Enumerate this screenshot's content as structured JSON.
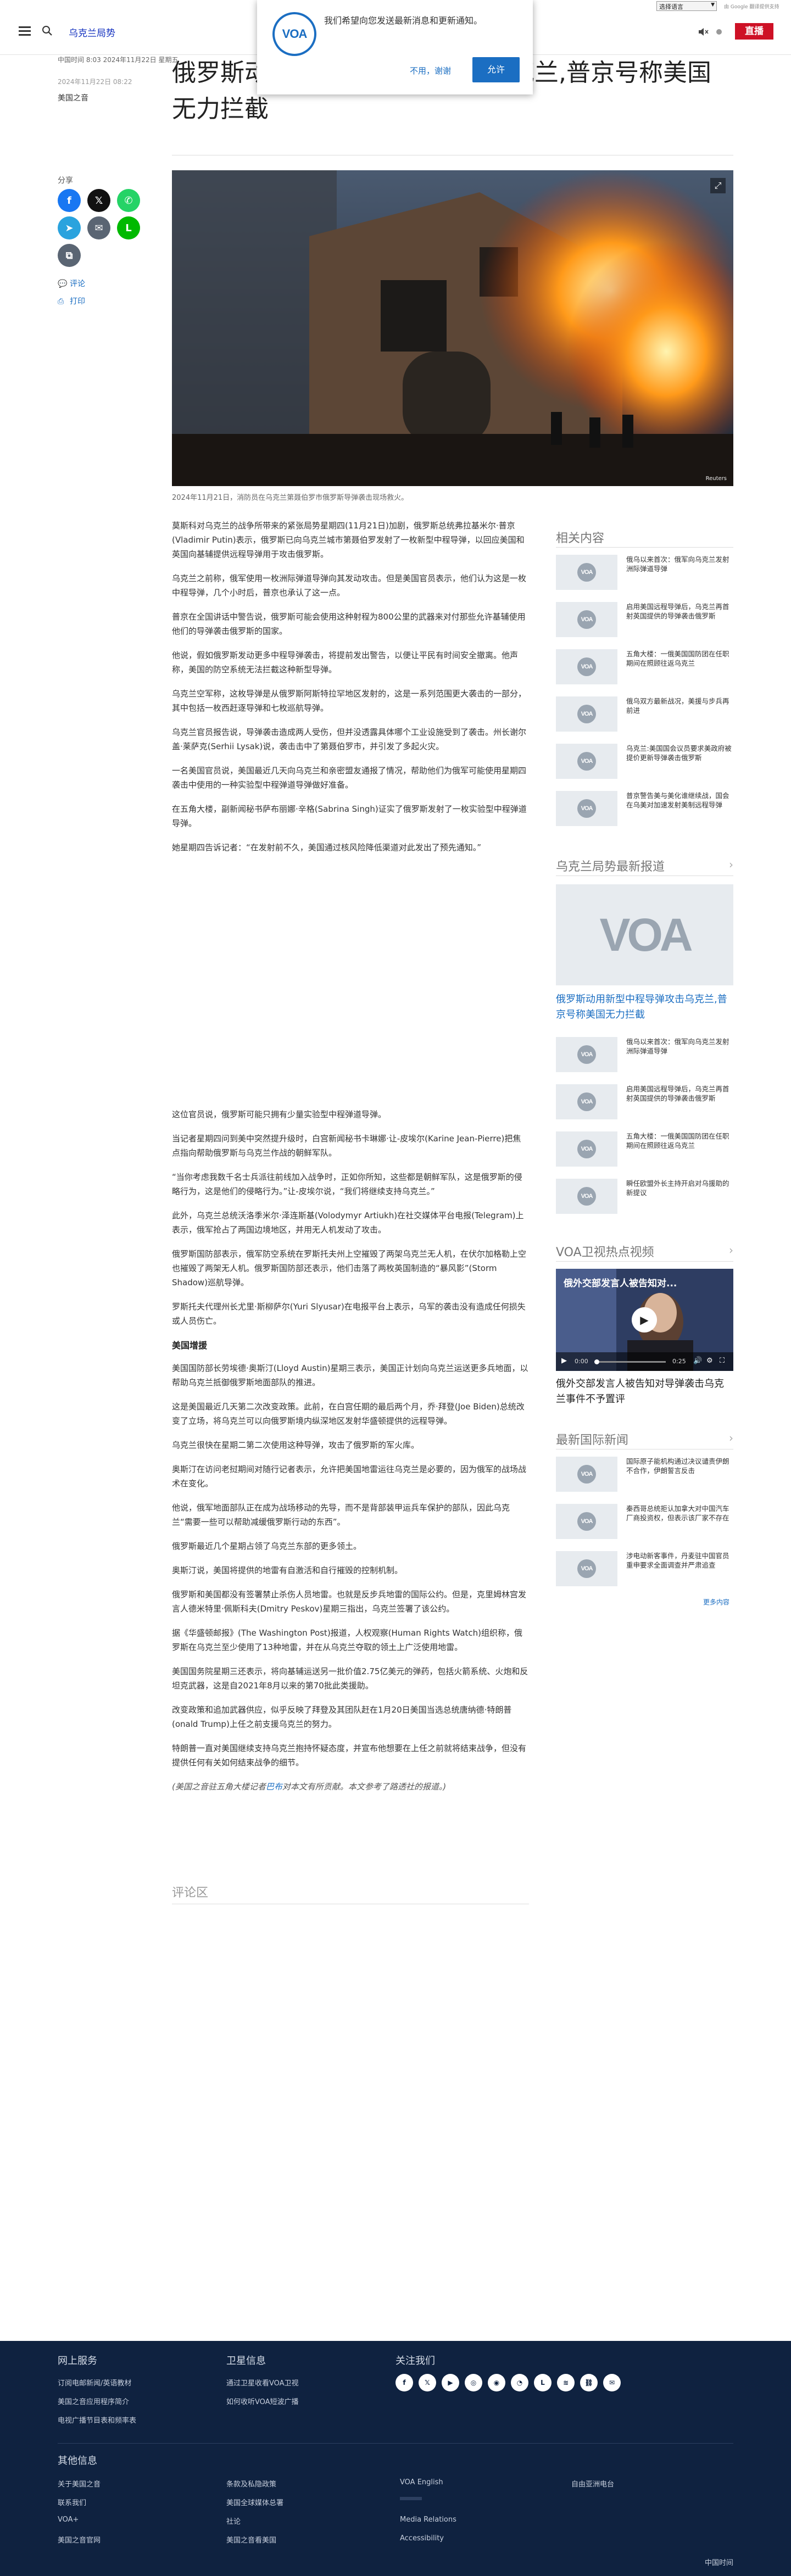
{
  "topbar": {
    "language_select": "选择语言",
    "google_translate": "由 Google 翻译提供支持"
  },
  "header": {
    "section_title": "乌克兰局势",
    "live_label": "直播"
  },
  "notification": {
    "text": "我们希望向您发送最新消息和更新通知。",
    "deny_label": "不用，谢谢",
    "allow_label": "允许",
    "logo_text": "VOA"
  },
  "article": {
    "meta": "中国时间 8:03 2024年11月22日 星期五",
    "date": "2024年11月22日 08:22",
    "source": "美国之音",
    "headline": "俄罗斯动用新型中程导弹攻击乌克兰,普京号称美国无力拦截",
    "caption": "2024年11月21日，消防员在乌克兰第聂伯罗市俄罗斯导弹袭击现场救火。",
    "photo_credit": "Reuters",
    "paragraphs_1": [
      "莫斯科对乌克兰的战争所带来的紧张局势星期四(11月21日)加剧，俄罗斯总统弗拉基米尔·普京(Vladimir Putin)表示，俄罗斯已向乌克兰城市第聂伯罗发射了一枚新型中程导弹，以回应美国和英国向基辅提供远程导弹用于攻击俄罗斯。",
      "乌克兰之前称，俄军使用一枚洲际弹道导弹向其发动攻击。但是美国官员表示，他们认为这是一枚中程导弹，几个小时后，普京也承认了这一点。",
      "普京在全国讲话中警告说，俄罗斯可能会使用这种射程为800公里的武器来对付那些允许基辅使用他们的导弹袭击俄罗斯的国家。",
      "他说，假如俄罗斯发动更多中程导弹袭击，将提前发出警告，以便让平民有时间安全撤离。他声称，美国的防空系统无法拦截这种新型导弹。",
      "乌克兰空军称，这枚导弹是从俄罗斯阿斯特拉罕地区发射的，这是一系列范围更大袭击的一部分，其中包括一枚西赶逐导弹和七枚巡航导弹。",
      "乌克兰官员报告说，导弹袭击造成两人受伤，但并没透露具体哪个工业设施受到了袭击。州长谢尔盖·莱萨克(Serhii Lysak)说，袭击击中了第聂伯罗市，并引发了多起火灾。",
      "一名美国官员说，美国最近几天向乌克兰和亲密盟友通报了情况，帮助他们为俄军可能使用星期四袭击中使用的一种实验型中程弹道导弹做好准备。",
      "在五角大楼，副新闻秘书萨布丽娜·辛格(Sabrina Singh)证实了俄罗斯发射了一枚实验型中程弹道导弹。",
      "她星期四告诉记者：“在发射前不久，美国通过核风险降低渠道对此发出了预先通知。”"
    ],
    "paragraphs_2": [
      "这位官员说，俄罗斯可能只拥有少量实验型中程弹道导弹。",
      "当记者星期四问到美中突然提升级时，白宫新闻秘书卡琳娜·让-皮埃尔(Karine Jean-Pierre)把焦点指向帮助俄罗斯与乌克兰作战的朝鲜军队。",
      "“当你考虑我数千名士兵派往前线加入战争时，正如你所知，这些都是朝鲜军队，这是俄罗斯的侵略行为，这是他们的侵略行为。”让-皮埃尔说，“我们将继续支持乌克兰。”",
      "此外，乌克兰总统沃洛季米尔·泽连斯基(Volodymyr Artiukh)在社交媒体平台电报(Telegram)上表示，俄军抢占了两国边境地区，并用无人机发动了攻击。",
      "俄罗斯国防部表示，俄军防空系统在罗斯托夫州上空摧毁了两架乌克兰无人机，在伏尔加格勒上空也摧毁了两架无人机。俄罗斯国防部还表示，他们击落了两枚英国制造的“暴风影”(Storm Shadow)巡航导弹。",
      "罗斯托夫代理州长尤里·斯柳萨尔(Yuri Slyusar)在电报平台上表示，乌军的袭击没有造成任何损失或人员伤亡。"
    ],
    "subhead": "美国增援",
    "paragraphs_3": [
      "美国国防部长劳埃德·奥斯汀(Lloyd Austin)星期三表示，美国正计划向乌克兰运送更多兵地面，以帮助乌克兰抵御俄罗斯地面部队的推进。",
      "这是美国最近几天第二次改变政策。此前，在白宫任期的最后两个月，乔·拜登(Joe Biden)总统改变了立场，将乌克兰可以向俄罗斯境内纵深地区发射华盛顿提供的远程导弹。",
      "乌克兰很快在星期二第二次使用这种导弹，攻击了俄罗斯的军火库。",
      "奥斯汀在访问老挝期间对随行记者表示，允许把美国地雷运往乌克兰是必要的，因为俄军的战场战术在变化。",
      "他说，俄军地面部队正在成为战场移动的先导，而不是背部装甲运兵车保护的部队，因此乌克兰“需要一些可以帮助减缓俄罗斯行动的东西”。",
      "俄罗斯最近几个星期占领了乌克兰东部的更多领土。",
      "奥斯汀说，美国将提供的地雷有自激活和自行摧毁的控制机制。",
      "俄罗斯和美国都没有签署禁止杀伤人员地雷。也就是反步兵地雷的国际公约。但是，克里姆林宫发言人德米特里·佩斯科夫(Dmitry Peskov)星期三指出，乌克兰签署了该公约。",
      "据《华盛顿邮报》(The Washington Post)报道，人权观察(Human Rights Watch)组织称，俄罗斯在乌克兰至少使用了13种地雷，并在从乌克兰夺取的领土上广泛使用地雷。",
      "美国国务院星期三还表示，将向基辅运送另一批价值2.75亿美元的弹药，包括火箭系统、火炮和反坦克武器，这是自2021年8月以来的第70批此类援助。",
      "改变政策和追加武器供应，似乎反映了拜登及其团队赶在1月20日美国当选总统唐纳德·特朗普(onald Trump)上任之前支援乌克兰的努力。",
      "特朗普一直对美国继续支持乌克兰抱持怀疑态度，并宣布他想要在上任之前就将结束战争，但没有提供任何有关如何结束战争的细节。"
    ],
    "credit_prefix": "(美国之音驻五角大楼记者",
    "credit_link": "巴布",
    "credit_suffix": "对本文有所贡献。本文参考了路透社的报道。)"
  },
  "share": {
    "label": "分享",
    "comment_label": "评论",
    "print_label": "打印"
  },
  "related": {
    "title": "相关内容",
    "items": [
      "俄乌以来首次：俄军向乌克兰发射洲际弹道导弹",
      "启用美国远程导弹后，乌克兰再首射英国提供的导弹袭击俄罗斯",
      "五角大楼：一俄美国国防团在任职期间在照顾往返乌克兰",
      "俄乌双方最新战况，美援与步兵再前进",
      "乌克兰:美国国会议员要求美政府被提价更新导弹袭击俄罗斯",
      "普京警告美与美化谁继续战，国会在乌美对加速发射美制远程导弹"
    ]
  },
  "latest": {
    "title": "乌克兰局势最新报道",
    "big_title": "俄罗斯动用新型中程导弹攻击乌克兰,普京号称美国无力拦截",
    "items": [
      "俄乌以来首次：俄军向乌克兰发射洲际弹道导弹",
      "启用美国远程导弹后，乌克兰再首射英国提供的导弹袭击俄罗斯",
      "五角大楼：一俄美国国防团在任职期间在照顾往返乌克兰",
      "瞬任欧盟外长主持开启对乌援助的新提议"
    ]
  },
  "video": {
    "section_title": "VOA卫视热点视频",
    "overlay_title": "俄外交部发言人被告知对...",
    "current_time": "0:00",
    "duration": "0:25",
    "caption": "俄外交部发言人被告知对导弹袭击乌克兰事件不予置评"
  },
  "international": {
    "title": "最新国际新闻",
    "items": [
      "国际原子能机构通过决议谴责伊朗不合作，伊朗誓言反击",
      "秦西哥总统拒认加拿大对中国汽车厂商投资权，但表示该厂家不存在",
      "涉电动新客事件，丹麦驻中国官员重申要求全面调查并严肃追查"
    ],
    "more_label": "更多内容"
  },
  "comments": {
    "title": "评论区"
  },
  "footer": {
    "col1_title": "网上服务",
    "col1_links": [
      "订阅电邮新闻/英语教材",
      "美国之音应用程序简介",
      "电视广播节目表和频率表"
    ],
    "col2_title": "卫星信息",
    "col2_links": [
      "通过卫星收看VOA卫视",
      "如何收听VOA短波广播"
    ],
    "col3_title": "关注我们",
    "social_icons": [
      "facebook-icon",
      "x-icon",
      "youtube-icon",
      "instagram-icon",
      "podcast-icon",
      "rss-icon",
      "line-icon",
      "rss-feed-icon",
      "link-icon",
      "email-icon"
    ],
    "other_title": "其他信息",
    "other_links": [
      [
        "关于美国之音",
        "联系我们",
        "VOA+",
        "美国之音官网"
      ],
      [
        "条款及私隐政策",
        "美国全球媒体总署",
        "社论",
        "美国之音看美国"
      ],
      [
        "VOA English",
        "",
        "Media Relations",
        "Accessibility"
      ],
      [
        "自由亚洲电台",
        "",
        "",
        ""
      ]
    ],
    "copyright": "中国时间"
  }
}
